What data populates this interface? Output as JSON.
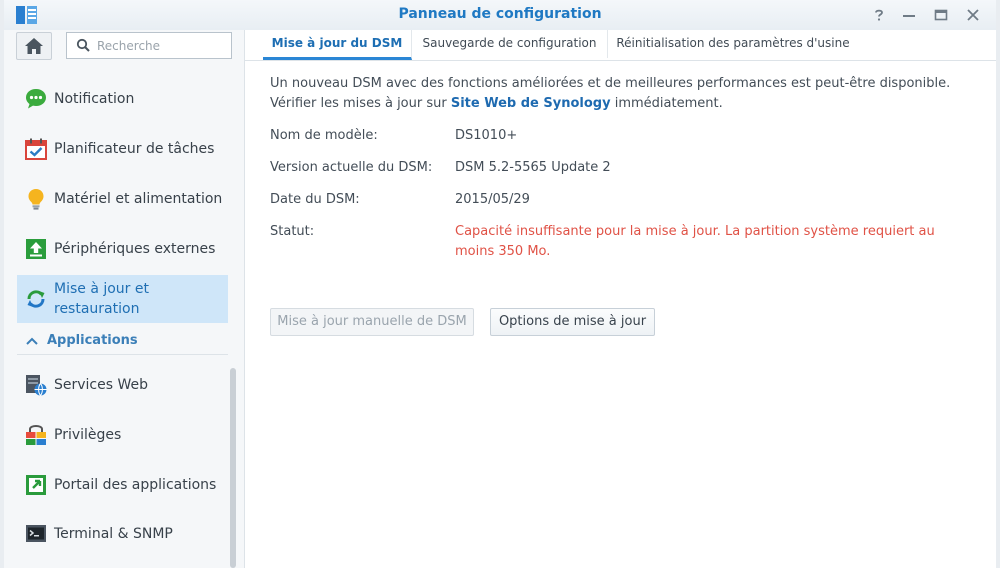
{
  "window": {
    "title": "Panneau de configuration"
  },
  "search": {
    "placeholder": "Recherche"
  },
  "sidebar": {
    "items": [
      {
        "label": "Notification",
        "icon": "notification-icon"
      },
      {
        "label": "Planificateur de tâches",
        "icon": "task-scheduler-icon"
      },
      {
        "label": "Matériel et alimentation",
        "icon": "hardware-power-icon"
      },
      {
        "label": "Périphériques externes",
        "icon": "external-devices-icon"
      },
      {
        "label": "Mise à jour et restauration",
        "icon": "update-restore-icon",
        "active": true
      }
    ],
    "section": "Applications",
    "apps": [
      {
        "label": "Services Web",
        "icon": "web-services-icon"
      },
      {
        "label": "Privilèges",
        "icon": "privileges-icon"
      },
      {
        "label": "Portail des applications",
        "icon": "app-portal-icon"
      },
      {
        "label": "Terminal & SNMP",
        "icon": "terminal-icon"
      }
    ]
  },
  "tabs": [
    {
      "label": "Mise à jour du DSM",
      "active": true
    },
    {
      "label": "Sauvegarde de configuration"
    },
    {
      "label": "Réinitialisation des paramètres d'usine"
    }
  ],
  "main": {
    "desc_before": "Un nouveau DSM avec des fonctions améliorées et de meilleures performances est peut-être disponible. Vérifier les mises à jour sur ",
    "desc_link": "Site Web de Synology",
    "desc_after": " immédiatement.",
    "fields": [
      {
        "label": "Nom de modèle:",
        "value": "DS1010+"
      },
      {
        "label": "Version actuelle du DSM:",
        "value": "DSM 5.2-5565 Update 2"
      },
      {
        "label": "Date du DSM:",
        "value": "2015/05/29"
      },
      {
        "label": "Statut:",
        "value": "Capacité insuffisante pour la mise à jour. La partition système requiert au moins 350 Mo."
      }
    ],
    "buttons": {
      "manual_update": "Mise à jour manuelle de DSM",
      "update_options": "Options de mise à jour"
    }
  },
  "colors": {
    "accent": "#1f79c3",
    "error": "#e05246",
    "active_bg": "#cfe6f9"
  }
}
